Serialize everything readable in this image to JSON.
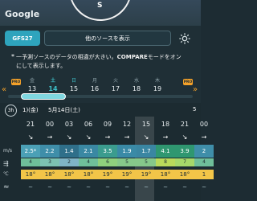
{
  "map": {
    "logo": "Google",
    "compass_label": "S"
  },
  "model_bar": {
    "model": "GFS27",
    "other_sources": "他のソースを表示"
  },
  "notice": {
    "star": "*",
    "text_a": "一予測ソースのデータの相違が大きい。",
    "text_b": "COMPARE",
    "text_c": "モードをオンにして表示します。"
  },
  "days": [
    {
      "dow": "金",
      "num": "13"
    },
    {
      "dow": "土",
      "num": "14"
    },
    {
      "dow": "日",
      "num": "15"
    },
    {
      "dow": "月",
      "num": "16"
    },
    {
      "dow": "火",
      "num": "17"
    },
    {
      "dow": "水",
      "num": "18"
    },
    {
      "dow": "木",
      "num": "19"
    }
  ],
  "badges": {
    "pro_left": "PRO",
    "pro_right": "PRO"
  },
  "forecast": {
    "hour_button": "3h",
    "date_left": "1)(金)",
    "date_main": "5月14日(土)",
    "date_right": "5",
    "times": [
      "21",
      "00",
      "03",
      "06",
      "09",
      "12",
      "15",
      "18",
      "21",
      "00"
    ],
    "directions": [
      "↘",
      "→",
      "↘",
      "↘",
      "→",
      "→",
      "↘",
      "→",
      "↘",
      "→"
    ],
    "speeds": [
      "2.5*",
      "2.2",
      "1.4",
      "2.1",
      "3.5",
      "1.9",
      "1.7",
      "4.1",
      "3.9",
      "2"
    ],
    "gusts": [
      "4",
      "3",
      "2",
      "4",
      "6",
      "5",
      "5",
      "8",
      "7",
      "4"
    ],
    "temps": [
      "18°",
      "18°",
      "18°",
      "18°",
      "19°",
      "19°",
      "19°",
      "18°",
      "18°",
      "1"
    ],
    "units": {
      "speed": "m/s",
      "temp": "℃"
    },
    "colors": {
      "speed": [
        "#4ba0b6",
        "#3f8ea9",
        "#2f6f8a",
        "#3a88a3",
        "#3b9c8e",
        "#3a8aa6",
        "#3a86a2",
        "#2f9770",
        "#2f9770",
        "#3f8ea9"
      ],
      "gust": [
        "#6fbf9a",
        "#7cc2b2",
        "#7fb4c6",
        "#6fbf9a",
        "#8fd07d",
        "#86c88a",
        "#86c88a",
        "#b9d95b",
        "#a6d86a",
        "#6fbf9a"
      ],
      "temp": "#f2c548",
      "accent": "#3ec0c9",
      "pro": "#f3a12a"
    }
  }
}
